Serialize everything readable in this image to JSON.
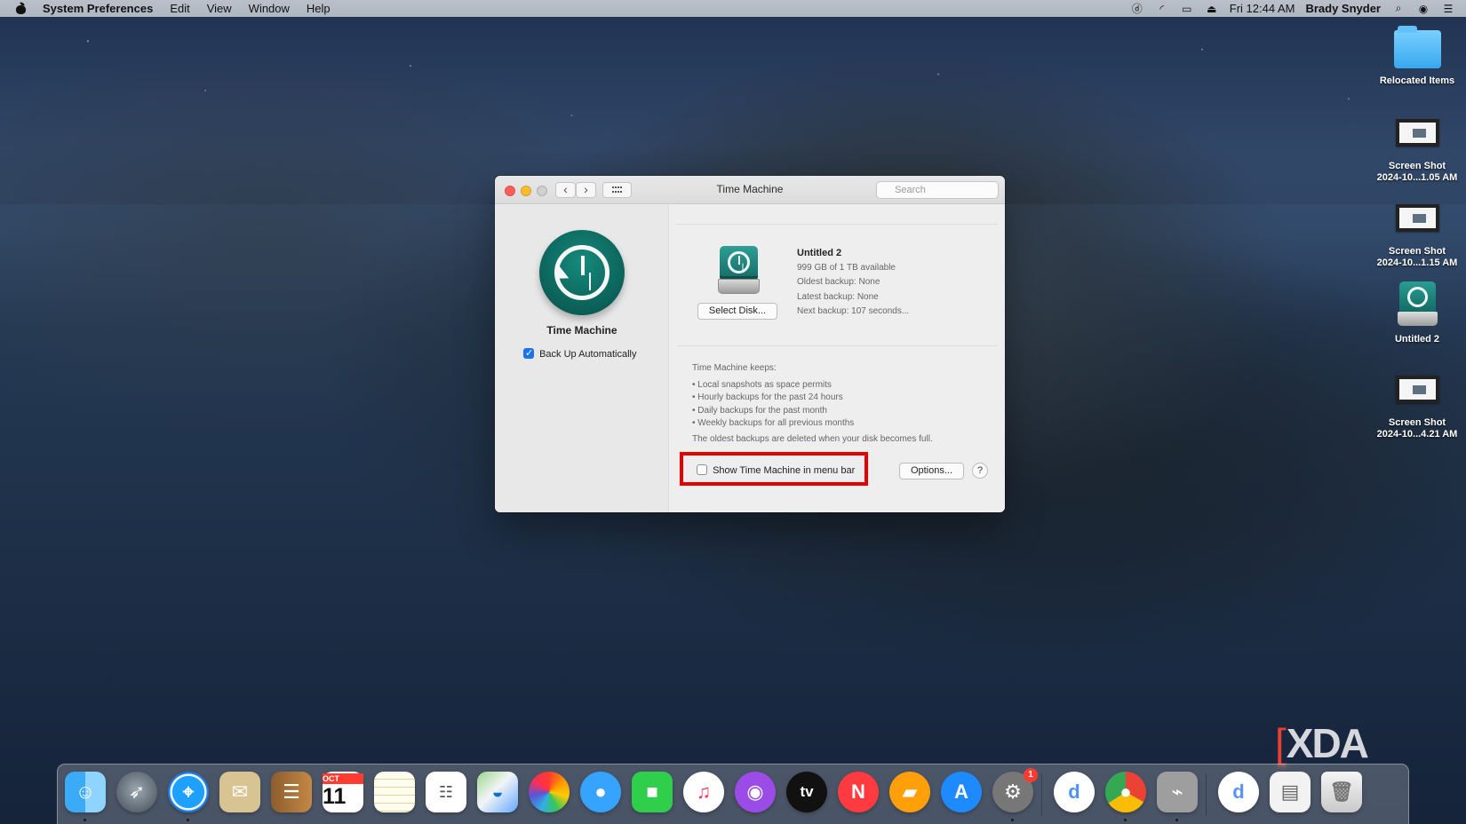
{
  "menubar": {
    "app": "System Preferences",
    "items": [
      "Edit",
      "View",
      "Window",
      "Help"
    ],
    "time": "Fri 12:44 AM",
    "user": "Brady Snyder",
    "status_icons": [
      "dashlane-icon",
      "wifi-icon",
      "airplay-icon",
      "eject-icon",
      "search-icon",
      "siri-icon",
      "control-center-icon"
    ]
  },
  "window": {
    "title": "Time Machine",
    "search_placeholder": "Search",
    "left": {
      "name": "Time Machine",
      "backup_auto_label": "Back Up Automatically",
      "backup_auto_checked": true
    },
    "disk": {
      "select_label": "Select Disk...",
      "name": "Untitled 2",
      "available": "999 GB of 1 TB available",
      "oldest": "Oldest backup: None",
      "latest": "Latest backup: None",
      "next": "Next backup: 107 seconds..."
    },
    "keeps": {
      "title": "Time Machine keeps:",
      "items": [
        "Local snapshots as space permits",
        "Hourly backups for the past 24 hours",
        "Daily backups for the past month",
        "Weekly backups for all previous months"
      ],
      "note": "The oldest backups are deleted when your disk becomes full."
    },
    "bottom": {
      "menu_toggle_label": "Show Time Machine in menu bar",
      "menu_toggle_checked": false,
      "options_label": "Options...",
      "help_label": "?"
    }
  },
  "desktop_icons": {
    "relocated": "Relocated Items",
    "shot1": "Screen Shot\n2024-10...1.05 AM",
    "shot2": "Screen Shot\n2024-10...1.15 AM",
    "disk": "Untitled 2",
    "shot3": "Screen Shot\n2024-10...4.21 AM"
  },
  "watermark": "XDA",
  "dock": {
    "apps": [
      "finder",
      "launchpad",
      "safari",
      "mail",
      "contacts",
      "calendar",
      "notes",
      "reminders",
      "maps",
      "photos",
      "messages",
      "facetime",
      "music",
      "podcasts",
      "tv",
      "news",
      "books",
      "app-store",
      "system-preferences",
      "dashlane",
      "chrome",
      "disk-utility",
      "downloads",
      "screenshot",
      "trash"
    ],
    "calendar_month": "OCT",
    "calendar_day": "11",
    "system_prefs_badge": "1",
    "tv_label": "tv"
  },
  "colors": {
    "accent_red": "#e50000",
    "checkbox_blue": "#1b74ea",
    "time_machine_green": "#0e6d63"
  }
}
